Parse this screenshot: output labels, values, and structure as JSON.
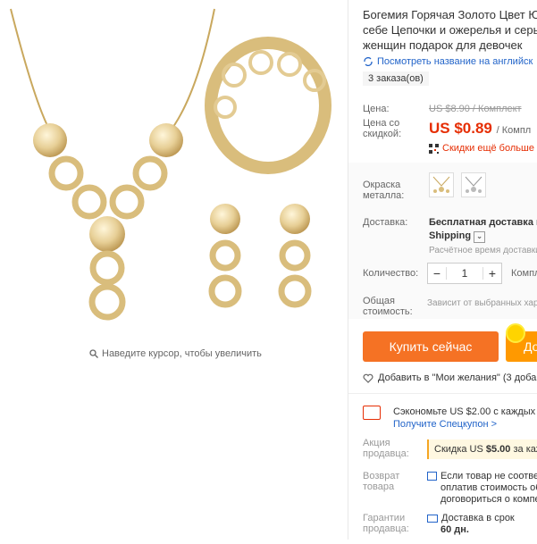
{
  "product": {
    "title_lines": [
      "Богемия Горячая Золото Цвет Ю",
      "себе Цепочки и ожерелья и серь",
      "женщин подарок для девочек"
    ],
    "translate_link": "Посмотреть название на английск",
    "orders_badge": "3 заказа(ов)"
  },
  "gallery": {
    "zoom_hint": "Наведите курсор, чтобы увеличить"
  },
  "price": {
    "old_label": "Цена:",
    "old_value": "US $8.90 / Комплект",
    "discount_label_1": "Цена со",
    "discount_label_2": "скидкой:",
    "current_value": "US $0.89",
    "unit": "/ Компл",
    "more_discount": "Скидки ещё больше в"
  },
  "options": {
    "color_label_1": "Окраска",
    "color_label_2": "металла:",
    "shipping_label": "Доставка:",
    "shipping_text_1": "Бесплатная доставка в I",
    "shipping_text_2": "Shipping",
    "shipping_sub": "Расчётное время доставки",
    "qty_label": "Количество:",
    "qty_minus": "−",
    "qty_value": "1",
    "qty_plus": "+",
    "qty_unit": "Компл",
    "total_label_1": "Общая",
    "total_label_2": "стоимость:",
    "total_value": "Зависит от выбранных хар"
  },
  "actions": {
    "buy_now": "Купить сейчас",
    "add_to_cart": "До",
    "wishlist": "Добавить в \"Мои желания\" (3 добав"
  },
  "promo": {
    "coupon_line_1": "Сэкономьте US $2.00 с каждых US",
    "coupon_link": "Получите Спецкупон >",
    "seller_label_1": "Акция",
    "seller_label_2": "продавца:",
    "seller_promo_prefix": "Скидка US ",
    "seller_promo_amount": "$5.00",
    "seller_promo_suffix": " за каж",
    "return_label_1": "Возврат",
    "return_label_2": "товара",
    "return_line_1": "Если товар не соответ",
    "return_line_2": "оплатив стоимость об",
    "return_line_3": "договориться о компе",
    "guarantee_label_1": "Гарантии",
    "guarantee_label_2": "продавца:",
    "guarantee_line_1": "Доставка в срок",
    "guarantee_line_2": "60 дн."
  },
  "colors": {
    "accent": "#e62e04",
    "buy_button": "#f57224",
    "cart_button": "#ff9900",
    "link": "#2264c9"
  }
}
